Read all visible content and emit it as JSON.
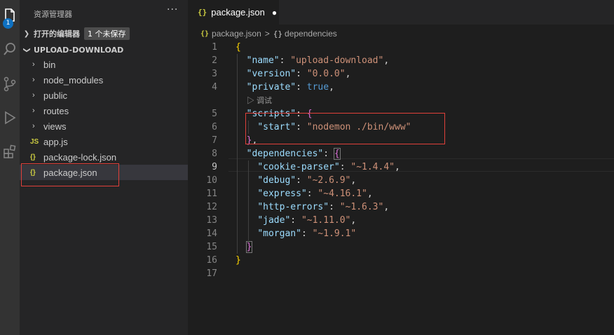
{
  "activity_bar": {
    "badge": "1",
    "icons": [
      "files-icon",
      "search-icon",
      "source-control-icon",
      "run-debug-icon",
      "extensions-icon"
    ]
  },
  "sidebar": {
    "title": "资源管理器",
    "more": "···",
    "open_editors": {
      "label": "打开的编辑器",
      "unsaved": "1 个未保存"
    },
    "project": "UPLOAD-DOWNLOAD",
    "items": [
      {
        "label": "bin",
        "type": "folder"
      },
      {
        "label": "node_modules",
        "type": "folder"
      },
      {
        "label": "public",
        "type": "folder"
      },
      {
        "label": "routes",
        "type": "folder"
      },
      {
        "label": "views",
        "type": "folder"
      },
      {
        "label": "app.js",
        "type": "js"
      },
      {
        "label": "package-lock.json",
        "type": "json"
      },
      {
        "label": "package.json",
        "type": "json"
      }
    ]
  },
  "tab": {
    "icon": "{}",
    "label": "package.json",
    "dirty": "●"
  },
  "breadcrumb": {
    "icon": "{}",
    "file": "package.json",
    "sep": ">",
    "node_icon": "{}",
    "node": "dependencies"
  },
  "codelens": "▷ 调试",
  "editor": {
    "active_line": 9,
    "line_numbers": [
      "1",
      "2",
      "3",
      "4",
      "5",
      "6",
      "7",
      "8",
      "9",
      "10",
      "11",
      "12",
      "13",
      "14",
      "15",
      "16",
      "17"
    ]
  },
  "code": {
    "name_key": "\"name\"",
    "name_val": "\"upload-download\"",
    "version_key": "\"version\"",
    "version_val": "\"0.0.0\"",
    "private_key": "\"private\"",
    "private_val": "true",
    "scripts_key": "\"scripts\"",
    "start_key": "\"start\"",
    "start_val": "\"nodemon ./bin/www\"",
    "deps_key": "\"dependencies\"",
    "deps": [
      {
        "k": "\"cookie-parser\"",
        "v": "\"~1.4.4\"",
        "comma": ","
      },
      {
        "k": "\"debug\"",
        "v": "\"~2.6.9\"",
        "comma": ","
      },
      {
        "k": "\"express\"",
        "v": "\"~4.16.1\"",
        "comma": ","
      },
      {
        "k": "\"http-errors\"",
        "v": "\"~1.6.3\"",
        "comma": ","
      },
      {
        "k": "\"jade\"",
        "v": "\"~1.11.0\"",
        "comma": ","
      },
      {
        "k": "\"morgan\"",
        "v": "\"~1.9.1\"",
        "comma": ""
      }
    ]
  },
  "colors": {
    "highlight_box": "#e0403a",
    "accent_badge": "#0e70c0"
  }
}
